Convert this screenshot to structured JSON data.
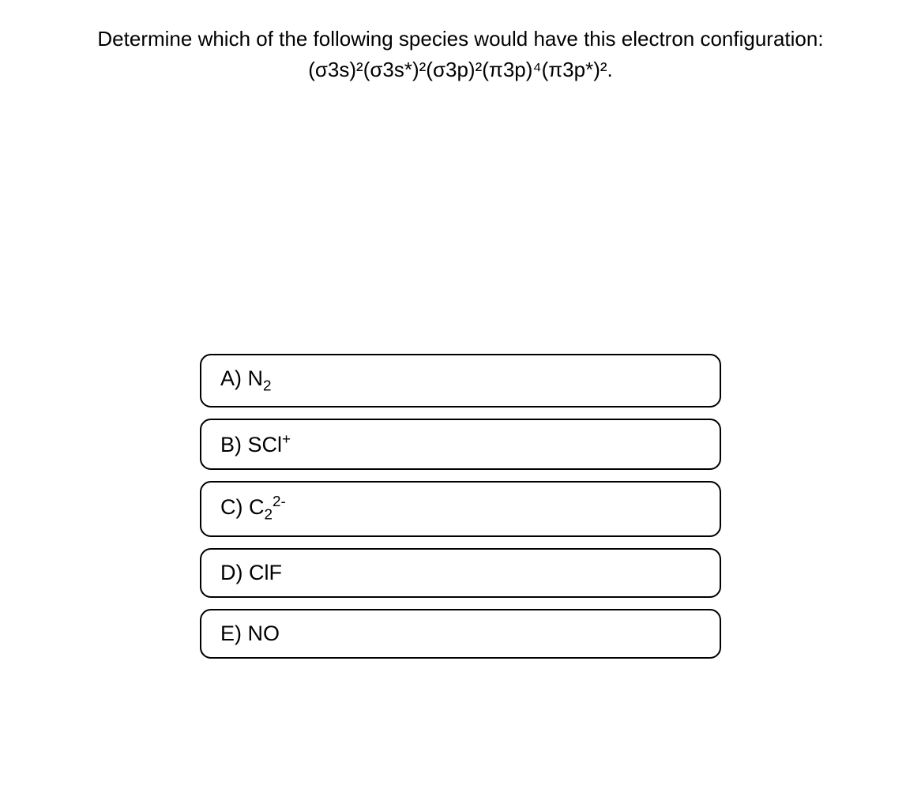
{
  "question": {
    "line1": "Determine which of the following species would have this electron configuration:",
    "line2": "(σ3s)²(σ3s*)²(σ3p)²(π3p)⁴(π3p*)²."
  },
  "options": {
    "a": {
      "letter": "A)",
      "text": "N",
      "sub": "2"
    },
    "b": {
      "letter": "B)",
      "text": "SCl",
      "sup": "+"
    },
    "c": {
      "letter": "C)",
      "text": "C",
      "sub": "2",
      "sup": "2-"
    },
    "d": {
      "letter": "D)",
      "text": "ClF"
    },
    "e": {
      "letter": "E)",
      "text": "NO"
    }
  }
}
